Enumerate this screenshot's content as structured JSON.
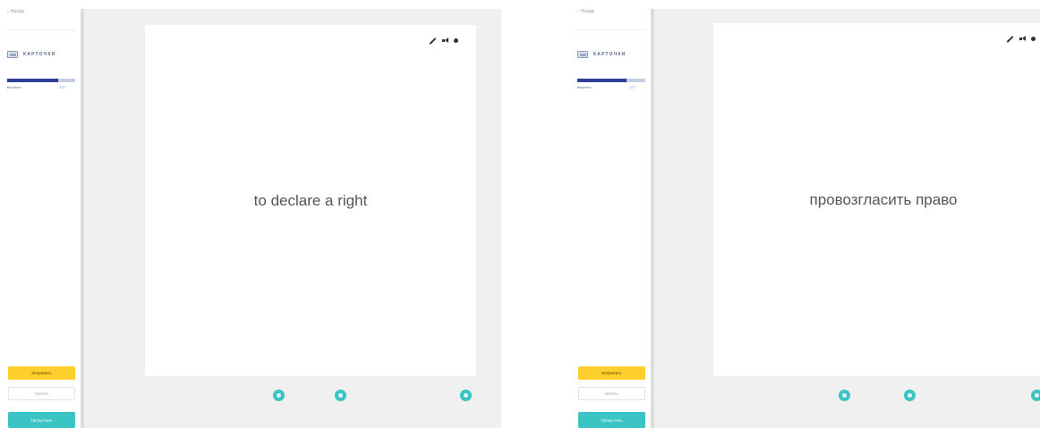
{
  "panels": [
    {
      "sidebar": {
        "back_label": "‹ Назад",
        "mode_label": "КАРТОЧКИ",
        "progress": {
          "fraction": 0.75,
          "left_label": "выучено",
          "right_label": "1/27"
        },
        "buttons": {
          "primary": "Исправить",
          "secondary": "Начать",
          "tertiary": "Пропустить"
        }
      },
      "card": {
        "text": "to declare a right"
      }
    },
    {
      "sidebar": {
        "back_label": "‹ Назад",
        "mode_label": "КАРТОЧКИ",
        "progress": {
          "fraction": 0.72,
          "left_label": "выучено",
          "right_label": "1/27"
        },
        "buttons": {
          "primary": "Исправить",
          "secondary": "Начать",
          "tertiary": "Пропустить"
        }
      },
      "card": {
        "text": "провозгласить право"
      }
    }
  ],
  "icons": {
    "card_icon": "flashcard-icon",
    "toolbar": [
      "pencil-icon",
      "speaker-icon",
      "star-icon"
    ],
    "nav": [
      "previous-icon",
      "flip-icon",
      "shuffle-icon"
    ]
  },
  "colors": {
    "accent_teal": "#3bc4c4",
    "accent_yellow": "#ffcf2e",
    "progress_fill": "#2f3f96",
    "progress_track": "#c5cde6",
    "workarea_bg": "#f0f0f0"
  }
}
